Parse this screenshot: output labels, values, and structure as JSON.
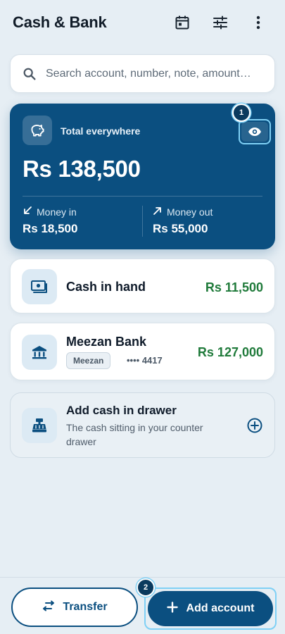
{
  "header": {
    "title": "Cash & Bank",
    "icons": [
      "calendar-icon",
      "filter-sliders-icon",
      "more-vertical-icon"
    ]
  },
  "search": {
    "placeholder": "Search account, number, note, amount…",
    "value": ""
  },
  "summary": {
    "label": "Total everywhere",
    "amount": "Rs 138,500",
    "money_in_label": "Money in",
    "money_in_value": "Rs 18,500",
    "money_out_label": "Money out",
    "money_out_value": "Rs 55,000",
    "toggle_icon": "eye-icon",
    "step_marker": "1"
  },
  "accounts": [
    {
      "name": "Cash in hand",
      "amount": "Rs 11,500",
      "icon": "cash-icon"
    },
    {
      "name": "Meezan Bank",
      "amount": "Rs 127,000",
      "bank_tag": "Meezan",
      "account_mask": "•••• 4417",
      "icon": "bank-icon"
    }
  ],
  "add_drawer": {
    "title": "Add cash in drawer",
    "description": "The cash sitting in your counter drawer",
    "icon": "cash-register-icon"
  },
  "bottom_bar": {
    "transfer_label": "Transfer",
    "add_account_label": "Add account",
    "step_marker": "2"
  },
  "colors": {
    "primary": "#0b4f80",
    "positive": "#1f7a3a",
    "background": "#e6eef4",
    "highlight": "#7fd0f5"
  }
}
